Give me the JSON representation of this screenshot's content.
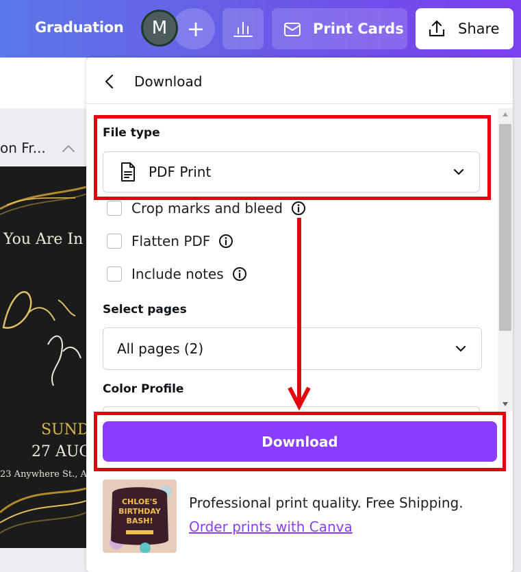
{
  "topbar": {
    "project_title": "Graduation",
    "avatar_initial": "M",
    "add_member_symbol": "+",
    "insights_icon": "bar-chart-icon",
    "print_cards_label": "Print Cards",
    "share_label": "Share"
  },
  "editor": {
    "page_title": "on Fr...",
    "design_lines": [
      "You Are In",
      "SUND",
      "27 AUG",
      "23 Anywhere St., A"
    ]
  },
  "panel": {
    "title": "Download",
    "file_type": {
      "label": "File type",
      "value": "PDF Print"
    },
    "options": [
      {
        "label": "Crop marks and bleed",
        "checked": false
      },
      {
        "label": "Flatten PDF",
        "checked": false
      },
      {
        "label": "Include notes",
        "checked": false
      }
    ],
    "select_pages": {
      "label": "Select pages",
      "value": "All pages (2)"
    },
    "color_profile": {
      "label": "Color Profile"
    },
    "download_label": "Download",
    "promo": {
      "thumb_text": "CHLOE'S BIRTHDAY BASH!",
      "text": "Professional print quality. Free Shipping.",
      "link": "Order prints with Canva"
    }
  },
  "colors": {
    "accent": "#8b3dff",
    "annotation": "#e4000f",
    "topbar_start": "#5a78e9",
    "topbar_end": "#7b3ff0"
  }
}
